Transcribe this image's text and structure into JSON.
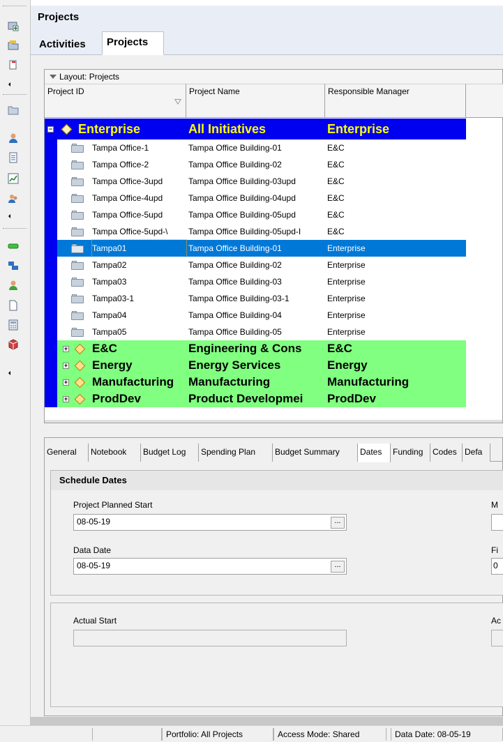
{
  "window": {
    "title": "Projects"
  },
  "view_tabs": [
    {
      "label": "Activities",
      "active": false
    },
    {
      "label": "Projects",
      "active": true
    }
  ],
  "grid": {
    "layout_label": "Layout: Projects",
    "columns": [
      "Project ID",
      "Project Name",
      "Responsible Manager"
    ],
    "rows": [
      {
        "kind": "group-blue",
        "id": "Enterprise",
        "name": "All Initiatives",
        "manager": "Enterprise",
        "expander": "−"
      },
      {
        "kind": "child",
        "id": "Tampa Office-1",
        "name": "Tampa Office Building-01",
        "manager": "E&C"
      },
      {
        "kind": "child",
        "id": "Tampa Office-2",
        "name": "Tampa Office Building-02",
        "manager": "E&C"
      },
      {
        "kind": "child",
        "id": "Tampa Office-3upd",
        "name": "Tampa Office Building-03upd",
        "manager": "E&C"
      },
      {
        "kind": "child",
        "id": "Tampa Office-4upd",
        "name": "Tampa Office Building-04upd",
        "manager": "E&C"
      },
      {
        "kind": "child",
        "id": "Tampa Office-5upd",
        "name": "Tampa Office Building-05upd",
        "manager": "E&C"
      },
      {
        "kind": "child",
        "id": "Tampa Office-5upd-\\",
        "name": "Tampa Office Building-05upd-I",
        "manager": "E&C"
      },
      {
        "kind": "child selected",
        "id": "Tampa01",
        "name": "Tampa Office Building-01",
        "manager": "Enterprise"
      },
      {
        "kind": "child",
        "id": "Tampa02",
        "name": "Tampa Office Building-02",
        "manager": "Enterprise"
      },
      {
        "kind": "child",
        "id": "Tampa03",
        "name": "Tampa Office Building-03",
        "manager": "Enterprise"
      },
      {
        "kind": "child",
        "id": "Tampa03-1",
        "name": "Tampa Office Building-03-1",
        "manager": "Enterprise"
      },
      {
        "kind": "child",
        "id": "Tampa04",
        "name": "Tampa Office Building-04",
        "manager": "Enterprise"
      },
      {
        "kind": "child",
        "id": "Tampa05",
        "name": "Tampa Office Building-05",
        "manager": "Enterprise"
      },
      {
        "kind": "group-green",
        "id": "E&C",
        "name": "Engineering & Cons",
        "manager": "E&C",
        "expander": "+"
      },
      {
        "kind": "group-green",
        "id": "Energy",
        "name": "Energy Services",
        "manager": "Energy",
        "expander": "+"
      },
      {
        "kind": "group-green",
        "id": "Manufacturing",
        "name": "Manufacturing",
        "manager": "Manufacturing",
        "expander": "+"
      },
      {
        "kind": "group-green",
        "id": "ProdDev",
        "name": "Product Developmei",
        "manager": "ProdDev",
        "expander": "+"
      }
    ]
  },
  "detail": {
    "tabs": [
      {
        "label": "General",
        "active": false
      },
      {
        "label": "Notebook",
        "active": false
      },
      {
        "label": "Budget Log",
        "active": false
      },
      {
        "label": "Spending Plan",
        "active": false
      },
      {
        "label": "Budget Summary",
        "active": false
      },
      {
        "label": "Dates",
        "active": true
      },
      {
        "label": "Funding",
        "active": false
      },
      {
        "label": "Codes",
        "active": false
      },
      {
        "label": "Defa",
        "active": false
      }
    ],
    "schedule_header": "Schedule Dates",
    "project_planned_start_label": "Project Planned Start",
    "project_planned_start_value": "08-05-19",
    "data_date_label": "Data Date",
    "data_date_value": "08-05-19",
    "right_label_1": "M",
    "right_label_2": "Fi",
    "right_value_2": "0",
    "actual_start_label": "Actual Start",
    "actual_start_value": "",
    "right_label_3": "Ac",
    "ellipsis": "..."
  },
  "status_bar": {
    "portfolio": "Portfolio: All Projects",
    "access_mode": "Access Mode: Shared",
    "data_date": "Data Date: 08-05-19"
  },
  "colors": {
    "group_blue": "#0000f0",
    "group_blue_text": "#ffff00",
    "group_green": "#80ff80",
    "selection": "#0078d7"
  },
  "toolbar_icons": [
    "open-project-icon",
    "open-folder-icon",
    "edit-icon",
    "folder-icon",
    "user-icon",
    "document-icon",
    "chart-icon",
    "users-icon",
    "green-bar-icon",
    "blue-blocks-icon",
    "person-icon",
    "file-icon",
    "calculator-icon",
    "cube-icon"
  ]
}
